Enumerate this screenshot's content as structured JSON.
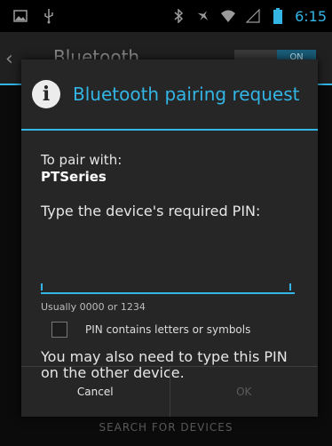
{
  "status_bar": {
    "time": "6:15",
    "left_icons": [
      "image-icon",
      "usb-icon"
    ],
    "right_icons": [
      "bluetooth-icon",
      "airplane-icon",
      "wifi-icon",
      "signal-icon",
      "battery-icon"
    ]
  },
  "background": {
    "title": "Bluetooth",
    "toggle_label": "ON",
    "bottom_text": "SEARCH FOR DEVICES"
  },
  "dialog": {
    "title": "Bluetooth pairing request",
    "pair_with_label": "To pair with:",
    "device_name": "PTSeries",
    "pin_prompt": "Type the device's required PIN:",
    "pin_value": "",
    "hint": "Usually 0000 or 1234",
    "checkbox_label": "PIN contains letters or symbols",
    "checkbox_checked": false,
    "note": "You may also need to type this PIN on the other device.",
    "cancel_label": "Cancel",
    "ok_label": "OK"
  },
  "colors": {
    "accent": "#33b5e5"
  }
}
